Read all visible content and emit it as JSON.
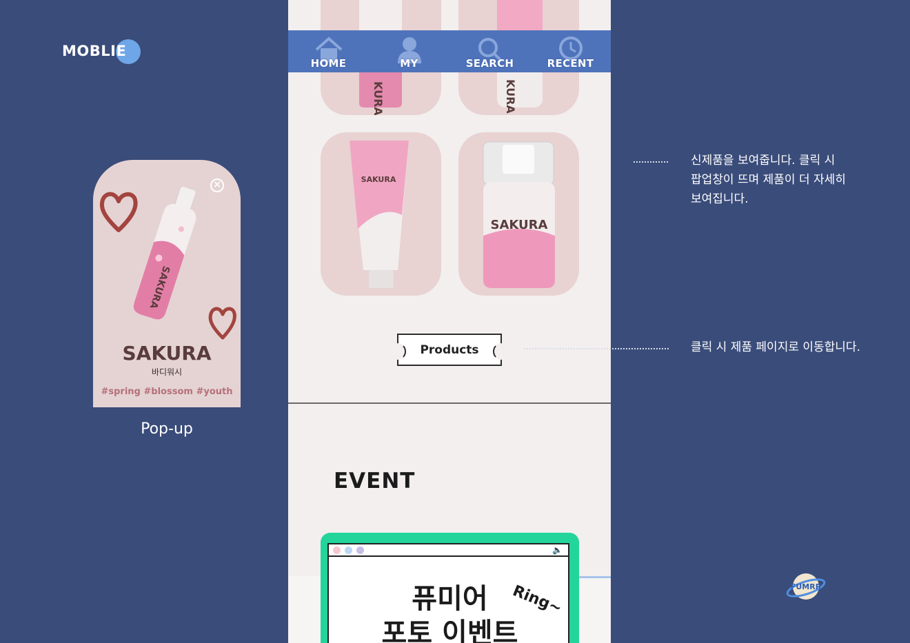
{
  "brand": {
    "label": "MOBLIE"
  },
  "popup": {
    "close_icon": "close-circle-icon",
    "product_name": "SAKURA",
    "product_type": "바디워시",
    "tags": "#spring #blossom #youth",
    "caption": "Pop-up"
  },
  "phone": {
    "nav": [
      {
        "label": "HOME",
        "icon": "home-icon"
      },
      {
        "label": "MY",
        "icon": "user-icon"
      },
      {
        "label": "SEARCH",
        "icon": "search-icon"
      },
      {
        "label": "RECENT",
        "icon": "clock-icon"
      }
    ],
    "products_button": "Products",
    "event_title": "EVENT",
    "event_banner": {
      "headline_line1": "퓨미어",
      "headline_line2": "포토 이벤트",
      "ring_text": "Ring~"
    }
  },
  "annotations": {
    "new_products": "신제품을 보여줍니다. 클릭 시\n팝업창이 뜨며 제품이 더 자세히\n보여집니다.",
    "products_link": "클릭 시 제품 페이지로 이동합니다."
  },
  "colors": {
    "background": "#3a4c7a",
    "nav_bar": "#4f73bb",
    "phone_bg": "#f3efef",
    "tile_bg": "#e8d2d2",
    "event_green": "#23d59a"
  }
}
